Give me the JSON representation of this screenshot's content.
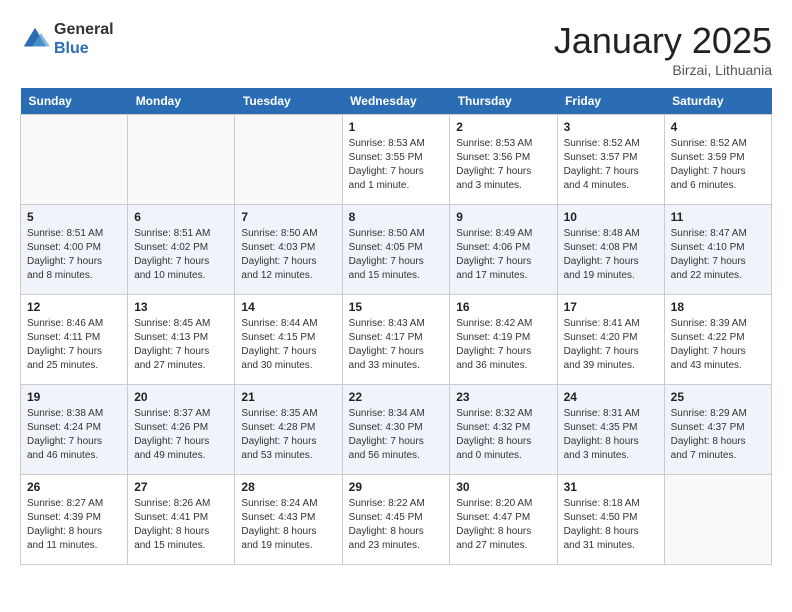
{
  "logo": {
    "general": "General",
    "blue": "Blue"
  },
  "title": "January 2025",
  "location": "Birzai, Lithuania",
  "days_of_week": [
    "Sunday",
    "Monday",
    "Tuesday",
    "Wednesday",
    "Thursday",
    "Friday",
    "Saturday"
  ],
  "weeks": [
    [
      {
        "day": "",
        "info": ""
      },
      {
        "day": "",
        "info": ""
      },
      {
        "day": "",
        "info": ""
      },
      {
        "day": "1",
        "info": "Sunrise: 8:53 AM\nSunset: 3:55 PM\nDaylight: 7 hours\nand 1 minute."
      },
      {
        "day": "2",
        "info": "Sunrise: 8:53 AM\nSunset: 3:56 PM\nDaylight: 7 hours\nand 3 minutes."
      },
      {
        "day": "3",
        "info": "Sunrise: 8:52 AM\nSunset: 3:57 PM\nDaylight: 7 hours\nand 4 minutes."
      },
      {
        "day": "4",
        "info": "Sunrise: 8:52 AM\nSunset: 3:59 PM\nDaylight: 7 hours\nand 6 minutes."
      }
    ],
    [
      {
        "day": "5",
        "info": "Sunrise: 8:51 AM\nSunset: 4:00 PM\nDaylight: 7 hours\nand 8 minutes."
      },
      {
        "day": "6",
        "info": "Sunrise: 8:51 AM\nSunset: 4:02 PM\nDaylight: 7 hours\nand 10 minutes."
      },
      {
        "day": "7",
        "info": "Sunrise: 8:50 AM\nSunset: 4:03 PM\nDaylight: 7 hours\nand 12 minutes."
      },
      {
        "day": "8",
        "info": "Sunrise: 8:50 AM\nSunset: 4:05 PM\nDaylight: 7 hours\nand 15 minutes."
      },
      {
        "day": "9",
        "info": "Sunrise: 8:49 AM\nSunset: 4:06 PM\nDaylight: 7 hours\nand 17 minutes."
      },
      {
        "day": "10",
        "info": "Sunrise: 8:48 AM\nSunset: 4:08 PM\nDaylight: 7 hours\nand 19 minutes."
      },
      {
        "day": "11",
        "info": "Sunrise: 8:47 AM\nSunset: 4:10 PM\nDaylight: 7 hours\nand 22 minutes."
      }
    ],
    [
      {
        "day": "12",
        "info": "Sunrise: 8:46 AM\nSunset: 4:11 PM\nDaylight: 7 hours\nand 25 minutes."
      },
      {
        "day": "13",
        "info": "Sunrise: 8:45 AM\nSunset: 4:13 PM\nDaylight: 7 hours\nand 27 minutes."
      },
      {
        "day": "14",
        "info": "Sunrise: 8:44 AM\nSunset: 4:15 PM\nDaylight: 7 hours\nand 30 minutes."
      },
      {
        "day": "15",
        "info": "Sunrise: 8:43 AM\nSunset: 4:17 PM\nDaylight: 7 hours\nand 33 minutes."
      },
      {
        "day": "16",
        "info": "Sunrise: 8:42 AM\nSunset: 4:19 PM\nDaylight: 7 hours\nand 36 minutes."
      },
      {
        "day": "17",
        "info": "Sunrise: 8:41 AM\nSunset: 4:20 PM\nDaylight: 7 hours\nand 39 minutes."
      },
      {
        "day": "18",
        "info": "Sunrise: 8:39 AM\nSunset: 4:22 PM\nDaylight: 7 hours\nand 43 minutes."
      }
    ],
    [
      {
        "day": "19",
        "info": "Sunrise: 8:38 AM\nSunset: 4:24 PM\nDaylight: 7 hours\nand 46 minutes."
      },
      {
        "day": "20",
        "info": "Sunrise: 8:37 AM\nSunset: 4:26 PM\nDaylight: 7 hours\nand 49 minutes."
      },
      {
        "day": "21",
        "info": "Sunrise: 8:35 AM\nSunset: 4:28 PM\nDaylight: 7 hours\nand 53 minutes."
      },
      {
        "day": "22",
        "info": "Sunrise: 8:34 AM\nSunset: 4:30 PM\nDaylight: 7 hours\nand 56 minutes."
      },
      {
        "day": "23",
        "info": "Sunrise: 8:32 AM\nSunset: 4:32 PM\nDaylight: 8 hours\nand 0 minutes."
      },
      {
        "day": "24",
        "info": "Sunrise: 8:31 AM\nSunset: 4:35 PM\nDaylight: 8 hours\nand 3 minutes."
      },
      {
        "day": "25",
        "info": "Sunrise: 8:29 AM\nSunset: 4:37 PM\nDaylight: 8 hours\nand 7 minutes."
      }
    ],
    [
      {
        "day": "26",
        "info": "Sunrise: 8:27 AM\nSunset: 4:39 PM\nDaylight: 8 hours\nand 11 minutes."
      },
      {
        "day": "27",
        "info": "Sunrise: 8:26 AM\nSunset: 4:41 PM\nDaylight: 8 hours\nand 15 minutes."
      },
      {
        "day": "28",
        "info": "Sunrise: 8:24 AM\nSunset: 4:43 PM\nDaylight: 8 hours\nand 19 minutes."
      },
      {
        "day": "29",
        "info": "Sunrise: 8:22 AM\nSunset: 4:45 PM\nDaylight: 8 hours\nand 23 minutes."
      },
      {
        "day": "30",
        "info": "Sunrise: 8:20 AM\nSunset: 4:47 PM\nDaylight: 8 hours\nand 27 minutes."
      },
      {
        "day": "31",
        "info": "Sunrise: 8:18 AM\nSunset: 4:50 PM\nDaylight: 8 hours\nand 31 minutes."
      },
      {
        "day": "",
        "info": ""
      }
    ]
  ]
}
